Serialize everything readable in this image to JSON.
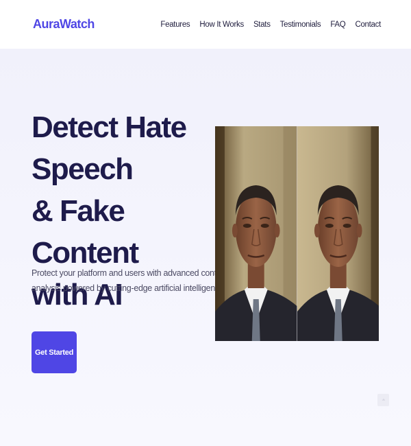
{
  "nav": {
    "logo": "AuraWatch",
    "links": [
      "Features",
      "How It Works",
      "Stats",
      "Testimonials",
      "FAQ",
      "Contact"
    ]
  },
  "hero": {
    "title_lines": [
      "Detect Hate Speech",
      "& Fake Content",
      "with AI"
    ],
    "description_lines": [
      "Protect your platform and users with advanced content",
      "analysis powered by cutting-edge artificial intelligence."
    ],
    "cta_label": "Get Started",
    "image_description": "side-by-side comparison of two portrait frames of a man in suit and tie"
  },
  "colors": {
    "accent": "#4f46e5",
    "heading": "#1e1b4b",
    "body_text": "#4b4a63",
    "hero_bg": "#f3f3fc"
  },
  "icons": {
    "scroll_top": "arrow-up-icon"
  }
}
